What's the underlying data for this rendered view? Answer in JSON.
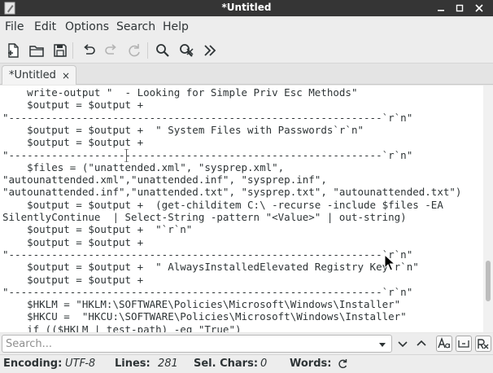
{
  "window": {
    "title": "*Untitled"
  },
  "menu": [
    "File",
    "Edit",
    "Options",
    "Search",
    "Help"
  ],
  "tab": {
    "label": "*Untitled",
    "close": "×"
  },
  "editor": {
    "lines": [
      "    write-output \"  - Looking for Simple Priv Esc Methods\"",
      "    $output = $output +",
      "\"-------------------------------------------------------------`r`n\"",
      "    $output = $output +  \" System Files with Passwords`r`n\"",
      "    $output = $output +",
      "\"-------------------------------------------------------------`r`n\"",
      "    $files = (\"unattended.xml\", \"sysprep.xml\",",
      "\"autounattended.xml\",\"unattended.inf\", \"sysprep.inf\",",
      "\"autounattended.inf\",\"unattended.txt\", \"sysprep.txt\", \"autounattended.txt\")",
      "    $output = $output +  (get-childitem C:\\ -recurse -include $files -EA",
      "SilentlyContinue  | Select-String -pattern \"<Value>\" | out-string)",
      "    $output = $output +  \"`r`n\"",
      "    $output = $output +",
      "\"-------------------------------------------------------------`r`n\"",
      "    $output = $output +  \" AlwaysInstalledElevated Registry Key`r`n\"",
      "    $output = $output +",
      "\"-------------------------------------------------------------`r`n\"",
      "    $HKLM = \"HKLM:\\SOFTWARE\\Policies\\Microsoft\\Windows\\Installer\"",
      "    $HKCU =  \"HKCU:\\SOFTWARE\\Policies\\Microsoft\\Windows\\Installer\"",
      "    if (($HKLM | test-path) -eq \"True\")"
    ]
  },
  "search": {
    "placeholder": "Search..."
  },
  "status": {
    "encoding_label": "Encoding:",
    "encoding_value": "UTF-8",
    "lines_label": "Lines:",
    "lines_value": "281",
    "sel_label": "Sel. Chars:",
    "sel_value": "0",
    "words_label": "Words:"
  }
}
